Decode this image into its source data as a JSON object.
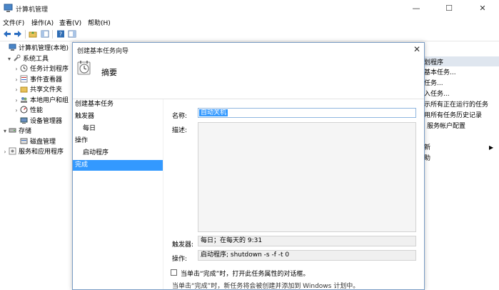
{
  "window": {
    "title": "计算机管理",
    "minimize": "—",
    "maximize": "☐",
    "close": "✕"
  },
  "menubar": {
    "items": [
      "文件(F)",
      "操作(A)",
      "查看(V)",
      "帮助(H)"
    ]
  },
  "tree": {
    "items": [
      {
        "label": "计算机管理(本地)",
        "level": 0,
        "arrow": "",
        "icon": "computer-icon"
      },
      {
        "label": "系统工具",
        "level": 1,
        "arrow": "▾",
        "icon": "tools-icon"
      },
      {
        "label": "任务计划程序",
        "level": 2,
        "arrow": "›",
        "icon": "clock-icon"
      },
      {
        "label": "事件查看器",
        "level": 2,
        "arrow": "›",
        "icon": "event-icon"
      },
      {
        "label": "共享文件夹",
        "level": 2,
        "arrow": "›",
        "icon": "folder-icon"
      },
      {
        "label": "本地用户和组",
        "level": 2,
        "arrow": "›",
        "icon": "users-icon"
      },
      {
        "label": "性能",
        "level": 2,
        "arrow": "›",
        "icon": "performance-icon"
      },
      {
        "label": "设备管理器",
        "level": 2,
        "arrow": "",
        "icon": "device-icon"
      },
      {
        "label": "存储",
        "level": 0,
        "arrow": "▾",
        "icon": "storage-icon"
      },
      {
        "label": "磁盘管理",
        "level": 2,
        "arrow": "",
        "icon": "disk-icon"
      },
      {
        "label": "服务和应用程序",
        "level": 0,
        "arrow": "›",
        "icon": "services-icon"
      }
    ]
  },
  "actions": {
    "header": "划程序",
    "items": [
      {
        "label": "基本任务..."
      },
      {
        "label": "任务..."
      },
      {
        "label": "入任务..."
      },
      {
        "label": "示所有正在运行的任务"
      },
      {
        "label": "用所有任务历史记录"
      },
      {
        "label": "服务帐户配置"
      },
      {
        "label": ""
      },
      {
        "label": "新"
      },
      {
        "label": "助"
      }
    ]
  },
  "dialog": {
    "title": "创建基本任务向导",
    "close": "✕",
    "header": "摘要",
    "steps": [
      {
        "label": "创建基本任务",
        "indent": 0,
        "active": false
      },
      {
        "label": "触发器",
        "indent": 0,
        "active": false
      },
      {
        "label": "每日",
        "indent": 1,
        "active": false
      },
      {
        "label": "操作",
        "indent": 0,
        "active": false
      },
      {
        "label": "启动程序",
        "indent": 1,
        "active": false
      },
      {
        "label": "完成",
        "indent": 0,
        "active": true
      }
    ],
    "name_label": "名称:",
    "name_value": "自动关机",
    "desc_label": "描述:",
    "trigger_label": "触发器:",
    "trigger_value": "每日；在每天的 9:31",
    "action_label": "操作:",
    "action_value": "启动程序; shutdown -s -f -t 0",
    "open_props_text": "当单击“完成”时，打开此任务属性的对话框。",
    "footer_text": "当单击“完成”时，新任务将会被创建并添加到 Windows 计划中。"
  }
}
